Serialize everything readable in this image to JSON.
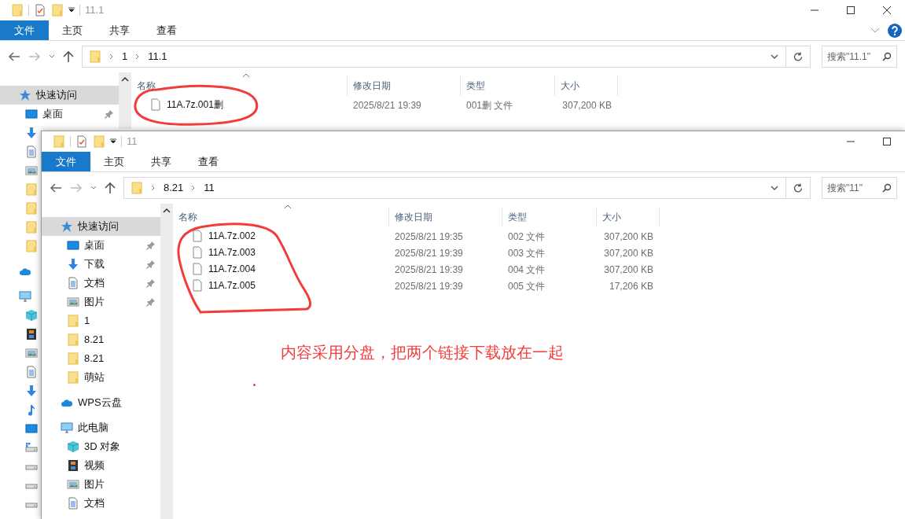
{
  "windows": [
    {
      "title": "11.1",
      "file_menu": "文件",
      "ribbon_tabs": [
        "主页",
        "共享",
        "查看"
      ],
      "close": true,
      "help": true,
      "path": [
        "1",
        "11.1"
      ],
      "search": {
        "placeholder": "搜索\"11.1\""
      },
      "sidebar": [
        {
          "kind": "quick",
          "label": "快速访问",
          "selected": true,
          "children": [
            {
              "kind": "desktop",
              "label": "桌面",
              "pinned": true
            },
            {
              "kind": "download"
            },
            {
              "kind": "doc"
            },
            {
              "kind": "pic"
            },
            {
              "kind": "folder"
            },
            {
              "kind": "folder"
            },
            {
              "kind": "folder"
            },
            {
              "kind": "folder"
            }
          ]
        },
        {
          "kind": "cloud"
        },
        {
          "kind": "pc",
          "children": [
            {
              "kind": "cube"
            },
            {
              "kind": "video"
            },
            {
              "kind": "pic"
            },
            {
              "kind": "doc"
            },
            {
              "kind": "download"
            },
            {
              "kind": "music"
            },
            {
              "kind": "desktop"
            },
            {
              "kind": "windrive"
            },
            {
              "kind": "drive"
            },
            {
              "kind": "drive"
            },
            {
              "kind": "drive"
            }
          ]
        }
      ],
      "columns": [
        "名称",
        "修改日期",
        "类型",
        "大小"
      ],
      "files": [
        {
          "name": "11A.7z.001删",
          "modified": "2025/8/21 19:39",
          "type": "001删 文件",
          "size": "307,200 KB"
        }
      ]
    },
    {
      "title": "11",
      "file_menu": "文件",
      "ribbon_tabs": [
        "主页",
        "共享",
        "查看"
      ],
      "path": [
        "8.21",
        "11"
      ],
      "search": {
        "placeholder": "搜索\"11\""
      },
      "sidebar": [
        {
          "kind": "quick",
          "label": "快速访问",
          "selected": true,
          "children": [
            {
              "kind": "desktop",
              "label": "桌面",
              "pinned": true
            },
            {
              "kind": "download",
              "label": "下载",
              "pinned": true
            },
            {
              "kind": "doc",
              "label": "文档",
              "pinned": true
            },
            {
              "kind": "pic",
              "label": "图片",
              "pinned": true
            },
            {
              "kind": "folder",
              "label": "1",
              "pinned": false
            },
            {
              "kind": "folder",
              "label": "8.21",
              "pinned": false
            },
            {
              "kind": "folder",
              "label": "8.21",
              "pinned": false
            },
            {
              "kind": "folder",
              "label": "萌站",
              "pinned": false
            }
          ]
        },
        {
          "kind": "cloud",
          "label": "WPS云盘"
        },
        {
          "kind": "pc",
          "label": "此电脑",
          "children": [
            {
              "kind": "cube",
              "label": "3D 对象"
            },
            {
              "kind": "video",
              "label": "视频"
            },
            {
              "kind": "pic",
              "label": "图片"
            },
            {
              "kind": "doc",
              "label": "文档"
            }
          ]
        }
      ],
      "columns": [
        "名称",
        "修改日期",
        "类型",
        "大小"
      ],
      "files": [
        {
          "name": "11A.7z.002",
          "modified": "2025/8/21 19:35",
          "type": "002 文件",
          "size": "307,200 KB"
        },
        {
          "name": "11A.7z.003",
          "modified": "2025/8/21 19:39",
          "type": "003 文件",
          "size": "307,200 KB"
        },
        {
          "name": "11A.7z.004",
          "modified": "2025/8/21 19:39",
          "type": "004 文件",
          "size": "307,200 KB"
        },
        {
          "name": "11A.7z.005",
          "modified": "2025/8/21 19:39",
          "type": "005 文件",
          "size": "17,206 KB"
        }
      ]
    }
  ],
  "annotation": {
    "note": "内容采用分盘，把两个链接下载放在一起"
  }
}
